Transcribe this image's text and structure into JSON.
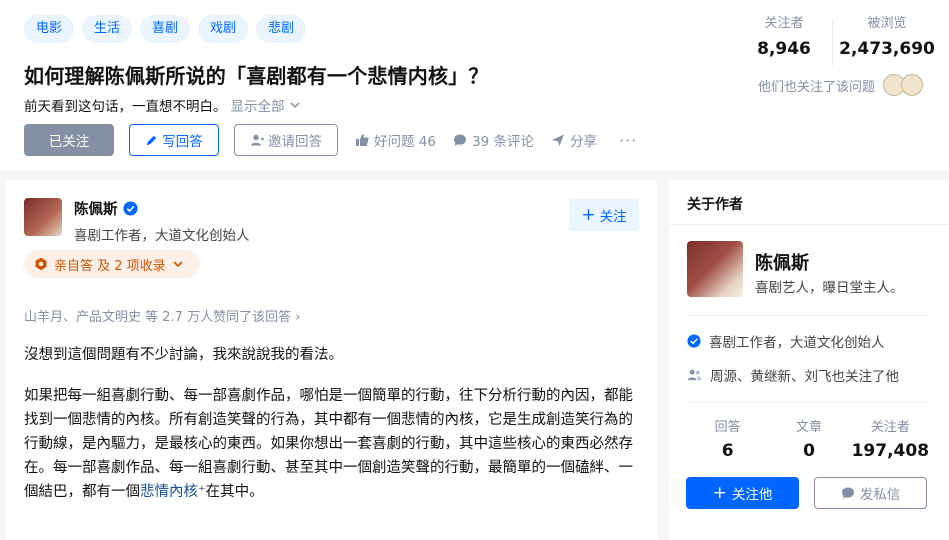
{
  "question": {
    "tags": [
      "电影",
      "生活",
      "喜剧",
      "戏剧",
      "悲剧"
    ],
    "title": "如何理解陈佩斯所说的「喜剧都有一个悲情内核」？",
    "description": "前天看到这句话，一直想不明白。",
    "show_all": "显示全部",
    "actions": {
      "followed": "已关注",
      "write_answer": "写回答",
      "invite": "邀请回答",
      "good_question": "好问题 46",
      "comments": "39 条评论",
      "share": "分享",
      "more": "···"
    },
    "stats": {
      "followers_label": "关注者",
      "followers_value": "8,946",
      "views_label": "被浏览",
      "views_value": "2,473,690"
    },
    "also_followed": "他们也关注了该问题"
  },
  "answer": {
    "author_name": "陈佩斯",
    "author_headline": "喜剧工作者，大道文化创始人",
    "follow_label": "关注",
    "badge": "亲自答 及 2 项收录",
    "voters": "山羊月、产品文明史 等 2.7 万人赞同了该回答 ›",
    "paragraph1": "沒想到這個問題有不少討論，我來說說我的看法。",
    "paragraph2_text": "如果把每一組喜劇行動、每一部喜劇作品，哪怕是一個簡單的行動，往下分析行動的內因，都能找到一個悲情的內核。所有創造笑聲的行為，其中都有一個悲情的內核，它是生成創造笑行為的行動線，是內驅力，是最核心的東西。如果你想出一套喜劇的行動，其中這些核心的東西必然存在。每一部喜劇作品、每一組喜劇行動、甚至其中一個創造笑聲的行動，最簡單的一個磕絆、一個結巴，都有一個",
    "paragraph2_link": "悲情內核",
    "paragraph2_link_mark": "⁺",
    "paragraph2_tail": "在其中。"
  },
  "sidebar": {
    "title": "关于作者",
    "name": "陈佩斯",
    "bio": "喜剧艺人，曝日堂主人。",
    "verified": "喜剧工作者，大道文化创始人",
    "mutual": "周源、黄继新、刘飞也关注了他",
    "stats": [
      {
        "label": "回答",
        "value": "6"
      },
      {
        "label": "文章",
        "value": "0"
      },
      {
        "label": "关注者",
        "value": "197,408"
      }
    ],
    "follow_him": "关注他",
    "message": "发私信"
  },
  "colors": {
    "brand": "#0066ff",
    "muted": "#8590a6",
    "badge_bg": "#fdf0e8",
    "badge_text": "#cc5500"
  }
}
